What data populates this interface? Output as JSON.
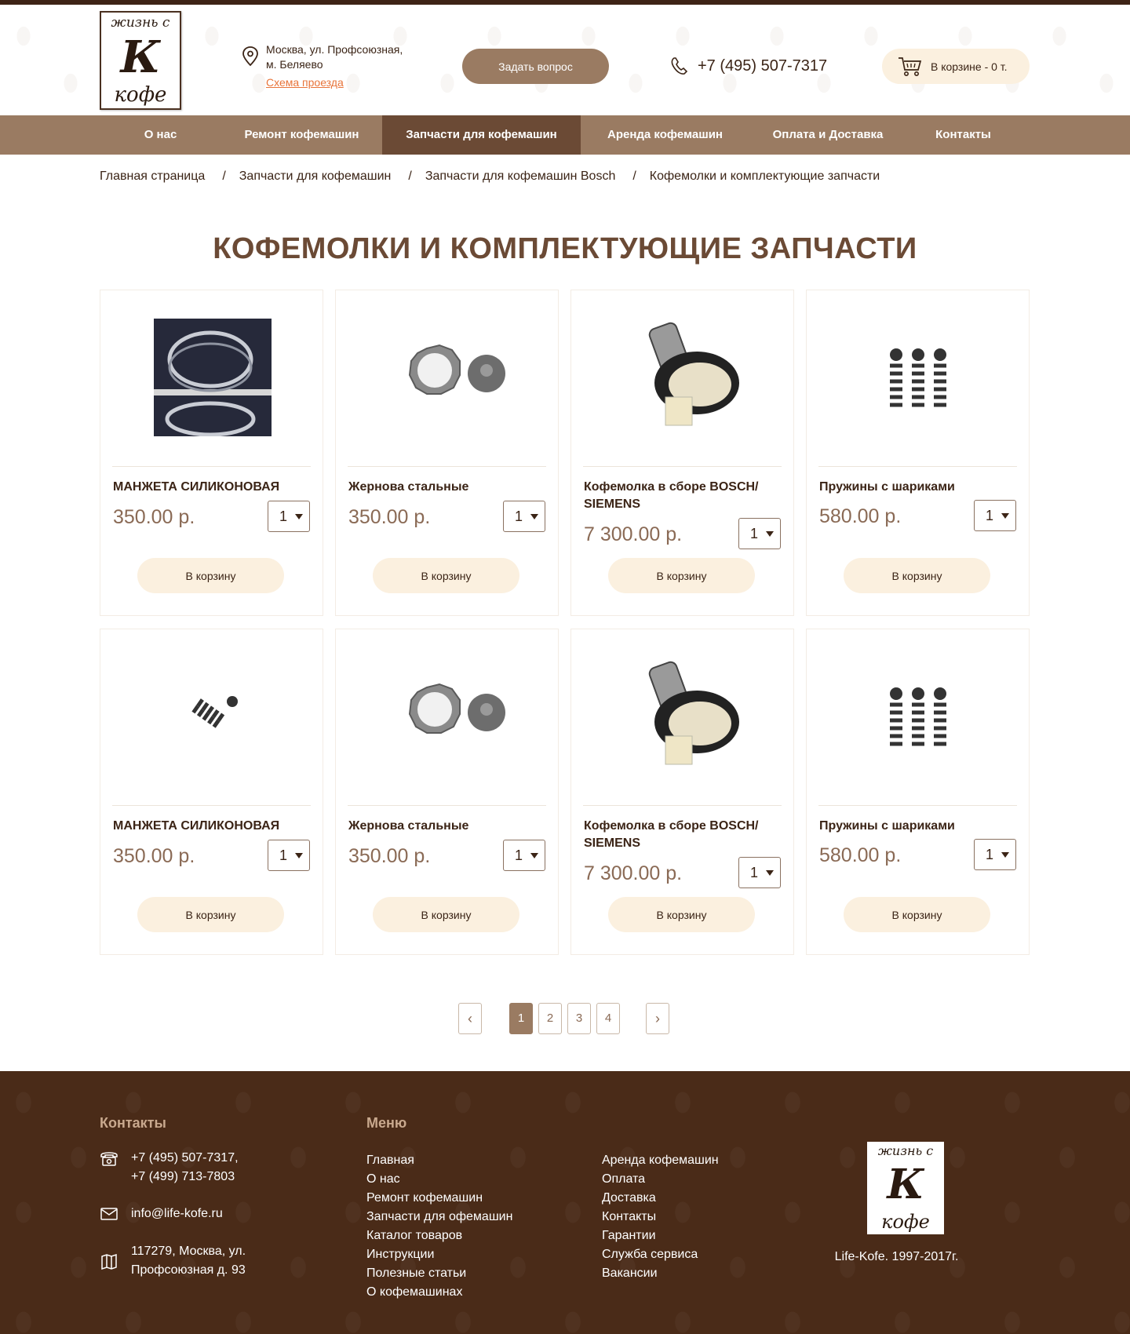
{
  "header": {
    "logo": {
      "line1": "жизнь с",
      "line2": "К",
      "line3": "кофе"
    },
    "address": "Москва, ул. Профсоюзная, м. Беляево",
    "map_link": "Схема проезда",
    "ask_button": "Задать вопрос",
    "phone": "+7 (495) 507-7317",
    "cart": "В корзине - 0 т."
  },
  "nav": {
    "items": [
      {
        "label": "О нас"
      },
      {
        "label": "Ремонт кофемашин"
      },
      {
        "label": "Запчасти для кофемашин"
      },
      {
        "label": "Аренда кофемашин"
      },
      {
        "label": "Оплата и Доставка"
      },
      {
        "label": "Контакты"
      }
    ],
    "active_index": 2
  },
  "breadcrumb": {
    "items": [
      "Главная страница",
      "Запчасти для кофемашин",
      "Запчасти для кофемашин Bosch",
      "Кофемолки и комплектующие запчасти"
    ],
    "separator": "/"
  },
  "page_title": "КОФЕМОЛКИ И КОМПЛЕКТУЮЩИЕ ЗАПЧАСТИ",
  "products": [
    {
      "name": "МАНЖЕТА СИЛИКОНОВАЯ",
      "price": "350.00 р.",
      "qty": "1",
      "button": "В корзину",
      "image": "seal-photo"
    },
    {
      "name": "Жернова стальные",
      "price": "350.00 р.",
      "qty": "1",
      "button": "В корзину",
      "image": "burrs-photo"
    },
    {
      "name": "Кофемолка в сборе BOSCH/ SIEMENS",
      "price": "7 300.00 р.",
      "qty": "1",
      "button": "В корзину",
      "image": "grinder-photo"
    },
    {
      "name": "Пружины с шариками",
      "price": "580.00 р.",
      "qty": "1",
      "button": "В корзину",
      "image": "springs-photo"
    },
    {
      "name": "МАНЖЕТА СИЛИКОНОВАЯ",
      "price": "350.00 р.",
      "qty": "1",
      "button": "В корзину",
      "image": "spring-single-photo"
    },
    {
      "name": "Жернова стальные",
      "price": "350.00 р.",
      "qty": "1",
      "button": "В корзину",
      "image": "burrs-photo"
    },
    {
      "name": "Кофемолка в сборе BOSCH/ SIEMENS",
      "price": "7 300.00 р.",
      "qty": "1",
      "button": "В корзину",
      "image": "grinder-photo"
    },
    {
      "name": "Пружины с шариками",
      "price": "580.00 р.",
      "qty": "1",
      "button": "В корзину",
      "image": "springs-photo"
    }
  ],
  "pagination": {
    "pages": [
      "1",
      "2",
      "3",
      "4"
    ],
    "active": "1",
    "prev": "‹",
    "next": "›"
  },
  "footer": {
    "contacts_title": "Контакты",
    "phone_line1": "+7 (495) 507-7317,",
    "phone_line2": "+7 (499) 713-7803",
    "email": "info@life-kofe.ru",
    "address_line1": "117279, Москва, ул.",
    "address_line2": "Профсоюзная д. 93",
    "menu_title": "Меню",
    "menu_col1": [
      "Главная",
      "О нас",
      "Ремонт кофемашин",
      "Запчасти для офемашин",
      "Каталог товаров",
      "Инструкции",
      "Полезные статьи",
      "О кофемашинах"
    ],
    "menu_col2": [
      "Аренда кофемашин",
      "Оплата",
      "Доставка",
      "Контакты",
      "Гарантии",
      "Служба сервиса",
      "Вакансии"
    ],
    "logo": {
      "line1": "жизнь с",
      "line2": "К",
      "line3": "кофе"
    },
    "copyright": "Life-Kofe. 1997-2017г."
  },
  "colors": {
    "brand_brown": "#9a7b62",
    "nav_active": "#6b4a35",
    "footer_bg": "#4a2b18",
    "button_cream": "#fbf0df",
    "link_orange": "#e8743a"
  }
}
